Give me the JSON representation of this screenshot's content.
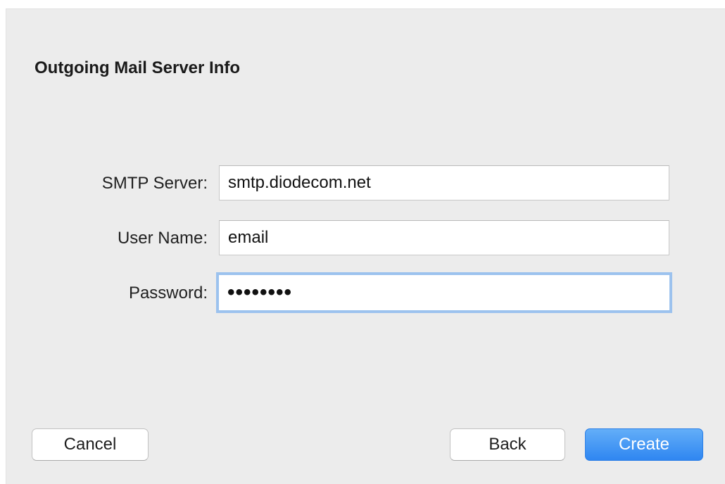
{
  "dialog": {
    "title": "Outgoing Mail Server Info"
  },
  "form": {
    "smtp_server": {
      "label": "SMTP Server:",
      "value": "smtp.diodecom.net"
    },
    "user_name": {
      "label": "User Name:",
      "value": "email"
    },
    "password": {
      "label": "Password:",
      "value": "••••••••"
    }
  },
  "buttons": {
    "cancel": "Cancel",
    "back": "Back",
    "create": "Create"
  },
  "colors": {
    "background": "#ececec",
    "accent": "#2f86f1",
    "focus_ring": "#9cc2ee"
  }
}
